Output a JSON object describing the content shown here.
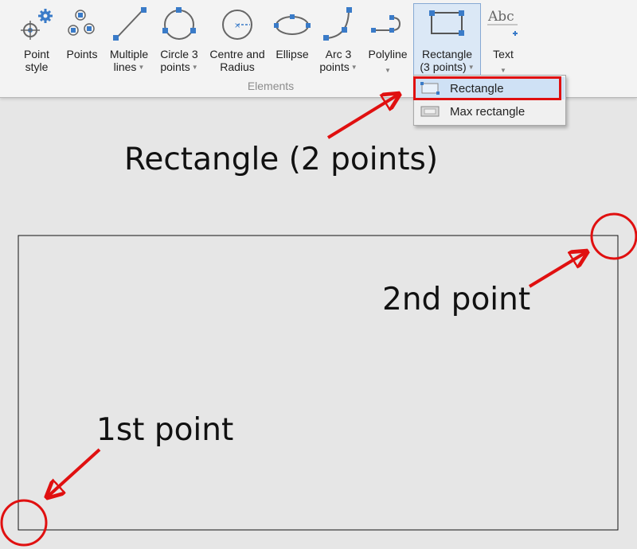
{
  "ribbon": {
    "group_label": "Elements",
    "buttons": [
      {
        "label": "Point\nstyle"
      },
      {
        "label": "Points"
      },
      {
        "label": "Multiple\nlines"
      },
      {
        "label": "Circle 3\npoints"
      },
      {
        "label": "Centre and\nRadius"
      },
      {
        "label": "Ellipse"
      },
      {
        "label": "Arc 3\npoints"
      },
      {
        "label": "Polyline"
      },
      {
        "label": "Rectangle\n(3 points)"
      },
      {
        "label": "Text"
      }
    ],
    "text_icon_glyph": "Abc"
  },
  "dropdown": {
    "items": [
      {
        "label": "Rectangle"
      },
      {
        "label": "Max rectangle"
      }
    ]
  },
  "annotations": {
    "title": "Rectangle (2 points)",
    "second_point": "2nd point",
    "first_point": "1st point"
  },
  "colors": {
    "accent_red": "#e01010",
    "icon_blue": "#3a7bc8",
    "canvas_bg": "#e6e6e6"
  }
}
